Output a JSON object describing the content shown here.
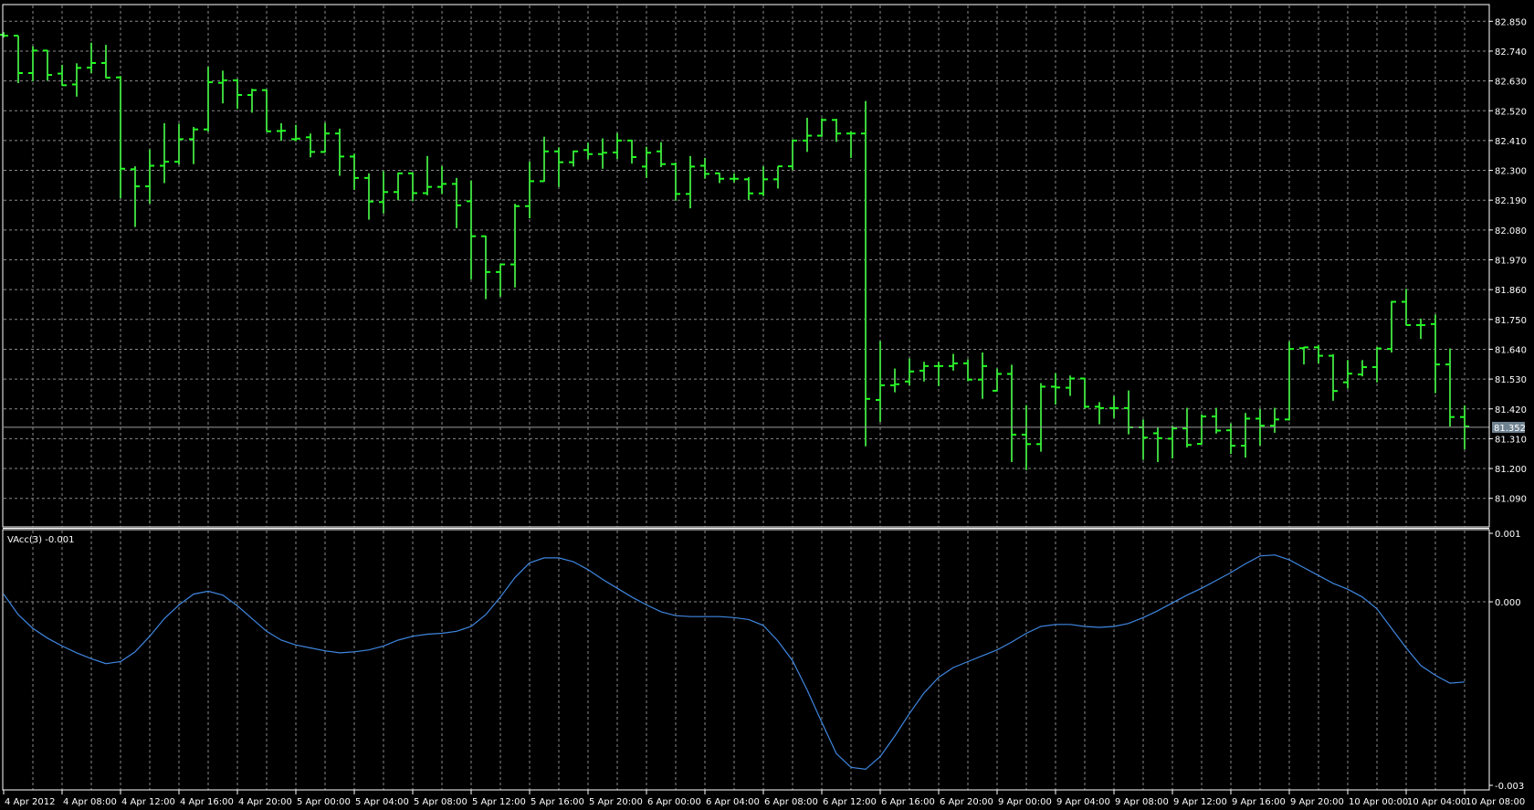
{
  "chart_data": [
    {
      "type": "ohlc",
      "title": "",
      "bar_color": "#3ccf3c",
      "tick_color": "#22ff22",
      "background": "#000000",
      "ylim": [
        81.0,
        82.87
      ],
      "y_ticks": [
        "82.850",
        "82.740",
        "82.630",
        "82.520",
        "82.410",
        "82.300",
        "82.190",
        "82.080",
        "81.970",
        "81.860",
        "81.750",
        "81.640",
        "81.530",
        "81.420",
        "81.310",
        "81.200",
        "81.090"
      ],
      "current_price": 81.352,
      "current_price_label": "81.352",
      "current_price_color": "#6f8291",
      "bars_ohlc": [
        [
          82.8,
          82.81,
          82.79,
          82.797
        ],
        [
          82.797,
          82.797,
          82.622,
          82.659
        ],
        [
          82.659,
          82.758,
          82.629,
          82.742
        ],
        [
          82.742,
          82.744,
          82.631,
          82.652
        ],
        [
          82.657,
          82.689,
          82.612,
          82.614
        ],
        [
          82.617,
          82.695,
          82.572,
          82.678
        ],
        [
          82.679,
          82.771,
          82.659,
          82.696
        ],
        [
          82.696,
          82.763,
          82.64,
          82.642
        ],
        [
          82.643,
          82.648,
          82.197,
          82.306
        ],
        [
          82.304,
          82.315,
          82.091,
          82.241
        ],
        [
          82.241,
          82.377,
          82.177,
          82.317
        ],
        [
          82.317,
          82.474,
          82.253,
          82.332
        ],
        [
          82.332,
          82.472,
          82.321,
          82.415
        ],
        [
          82.415,
          82.46,
          82.323,
          82.451
        ],
        [
          82.451,
          82.682,
          82.443,
          82.625
        ],
        [
          82.623,
          82.668,
          82.547,
          82.632
        ],
        [
          82.632,
          82.637,
          82.527,
          82.578
        ],
        [
          82.578,
          82.601,
          82.513,
          82.596
        ],
        [
          82.596,
          82.598,
          82.444,
          82.444
        ],
        [
          82.445,
          82.474,
          82.409,
          82.446
        ],
        [
          82.415,
          82.468,
          82.407,
          82.417
        ],
        [
          82.422,
          82.436,
          82.348,
          82.368
        ],
        [
          82.368,
          82.475,
          82.366,
          82.436
        ],
        [
          82.436,
          82.454,
          82.28,
          82.351
        ],
        [
          82.351,
          82.362,
          82.228,
          82.272
        ],
        [
          82.272,
          82.289,
          82.118,
          82.185
        ],
        [
          82.183,
          82.297,
          82.141,
          82.22
        ],
        [
          82.22,
          82.292,
          82.19,
          82.289
        ],
        [
          82.289,
          82.292,
          82.186,
          82.216
        ],
        [
          82.216,
          82.353,
          82.208,
          82.239
        ],
        [
          82.239,
          82.316,
          82.213,
          82.25
        ],
        [
          82.25,
          82.272,
          82.087,
          82.171
        ],
        [
          82.186,
          82.263,
          81.898,
          82.057
        ],
        [
          82.057,
          82.059,
          81.825,
          81.925
        ],
        [
          81.925,
          81.954,
          81.834,
          81.953
        ],
        [
          81.953,
          82.177,
          81.868,
          82.168
        ],
        [
          82.168,
          82.332,
          82.123,
          82.26
        ],
        [
          82.26,
          82.424,
          82.258,
          82.37
        ],
        [
          82.37,
          82.385,
          82.239,
          82.33
        ],
        [
          82.33,
          82.373,
          82.314,
          82.37
        ],
        [
          82.375,
          82.402,
          82.34,
          82.36
        ],
        [
          82.36,
          82.418,
          82.306,
          82.365
        ],
        [
          82.366,
          82.438,
          82.342,
          82.41
        ],
        [
          82.41,
          82.413,
          82.325,
          82.349
        ],
        [
          82.314,
          82.387,
          82.272,
          82.365
        ],
        [
          82.37,
          82.404,
          82.312,
          82.323
        ],
        [
          82.323,
          82.329,
          82.188,
          82.213
        ],
        [
          82.213,
          82.353,
          82.16,
          82.314
        ],
        [
          82.317,
          82.346,
          82.269,
          82.287
        ],
        [
          82.289,
          82.291,
          82.253,
          82.269
        ],
        [
          82.269,
          82.289,
          82.255,
          82.269
        ],
        [
          82.267,
          82.275,
          82.19,
          82.215
        ],
        [
          82.215,
          82.315,
          82.205,
          82.267
        ],
        [
          82.267,
          82.315,
          82.233,
          82.315
        ],
        [
          82.315,
          82.413,
          82.301,
          82.41
        ],
        [
          82.41,
          82.494,
          82.368,
          82.428
        ],
        [
          82.428,
          82.492,
          82.424,
          82.486
        ],
        [
          82.486,
          82.49,
          82.405,
          82.436
        ],
        [
          82.436,
          82.445,
          82.346,
          82.436
        ],
        [
          82.436,
          82.556,
          81.282,
          81.457
        ],
        [
          81.453,
          81.67,
          81.372,
          81.507
        ],
        [
          81.507,
          81.569,
          81.481,
          81.511
        ],
        [
          81.521,
          81.606,
          81.507,
          81.558
        ],
        [
          81.561,
          81.594,
          81.521,
          81.578
        ],
        [
          81.578,
          81.594,
          81.504,
          81.578
        ],
        [
          81.578,
          81.623,
          81.561,
          81.588
        ],
        [
          81.588,
          81.603,
          81.522,
          81.528
        ],
        [
          81.528,
          81.628,
          81.457,
          81.578
        ],
        [
          81.487,
          81.569,
          81.485,
          81.549
        ],
        [
          81.549,
          81.583,
          81.224,
          81.325
        ],
        [
          81.325,
          81.434,
          81.194,
          81.29
        ],
        [
          81.29,
          81.515,
          81.262,
          81.502
        ],
        [
          81.502,
          81.552,
          81.436,
          81.499
        ],
        [
          81.498,
          81.543,
          81.468,
          81.532
        ],
        [
          81.532,
          81.535,
          81.421,
          81.428
        ],
        [
          81.428,
          81.445,
          81.363,
          81.423
        ],
        [
          81.423,
          81.468,
          81.386,
          81.423
        ],
        [
          81.423,
          81.488,
          81.326,
          81.352
        ],
        [
          81.352,
          81.381,
          81.232,
          81.314
        ],
        [
          81.33,
          81.352,
          81.224,
          81.312
        ],
        [
          81.31,
          81.358,
          81.237,
          81.348
        ],
        [
          81.348,
          81.424,
          81.278,
          81.287
        ],
        [
          81.291,
          81.4,
          81.289,
          81.392
        ],
        [
          81.392,
          81.424,
          81.329,
          81.34
        ],
        [
          81.341,
          81.366,
          81.254,
          81.284
        ],
        [
          81.284,
          81.405,
          81.24,
          81.384
        ],
        [
          81.384,
          81.42,
          81.284,
          81.358
        ],
        [
          81.358,
          81.424,
          81.332,
          81.381
        ],
        [
          81.381,
          81.669,
          81.377,
          81.641
        ],
        [
          81.644,
          81.649,
          81.584,
          81.647
        ],
        [
          81.647,
          81.656,
          81.588,
          81.616
        ],
        [
          81.616,
          81.622,
          81.45,
          81.486
        ],
        [
          81.518,
          81.6,
          81.495,
          81.55
        ],
        [
          81.547,
          81.6,
          81.54,
          81.574
        ],
        [
          81.574,
          81.649,
          81.518,
          81.643
        ],
        [
          81.641,
          81.818,
          81.628,
          81.815
        ],
        [
          81.815,
          81.863,
          81.729,
          81.729
        ],
        [
          81.729,
          81.753,
          81.678,
          81.729
        ],
        [
          81.733,
          81.768,
          81.478,
          81.584
        ],
        [
          81.584,
          81.643,
          81.355,
          81.39
        ],
        [
          81.39,
          81.433,
          81.271,
          81.355
        ]
      ]
    },
    {
      "type": "line",
      "indicator_label": "VAcc(3) -0.001",
      "line_color": "#3f86e0",
      "ylim": [
        -0.00275,
        0.00106
      ],
      "y_ticks": [
        {
          "value": 0.001,
          "label": "0.001"
        },
        {
          "value": 0.0,
          "label": "0.000"
        },
        {
          "value": -0.00275,
          "label": "-0.003"
        }
      ],
      "values": [
        0.000112,
        -0.000188,
        -0.000388,
        -0.000531,
        -0.000645,
        -0.000745,
        -0.000831,
        -0.000903,
        -0.000873,
        -0.000731,
        -0.000503,
        -0.000245,
        -4.5e-05,
        0.000112,
        0.000155,
        9.7e-05,
        -5.9e-05,
        -0.000245,
        -0.000431,
        -0.00056,
        -0.000631,
        -0.000673,
        -0.000716,
        -0.000745,
        -0.000731,
        -0.000703,
        -0.000645,
        -0.00056,
        -0.000503,
        -0.000473,
        -0.00046,
        -0.000431,
        -0.00036,
        -0.000188,
        6.9e-05,
        0.000355,
        0.000569,
        0.000641,
        0.000641,
        0.000584,
        0.000469,
        0.000327,
        0.000197,
        6.9e-05,
        -4.5e-05,
        -0.000145,
        -0.000203,
        -0.000216,
        -0.000216,
        -0.000216,
        -0.000231,
        -0.000259,
        -0.000345,
        -0.000573,
        -0.00086,
        -0.001288,
        -0.00176,
        -0.002217,
        -0.002417,
        -0.002445,
        -0.00226,
        -0.00196,
        -0.001631,
        -0.001331,
        -0.001103,
        -0.00096,
        -0.000873,
        -0.000788,
        -0.000703,
        -0.000588,
        -0.00046,
        -0.00036,
        -0.000331,
        -0.000331,
        -0.00036,
        -0.000373,
        -0.00036,
        -0.000316,
        -0.000231,
        -0.000131,
        -1.6e-05,
        9.7e-05,
        0.000197,
        0.000312,
        0.000427,
        0.000555,
        0.000669,
        0.000684,
        0.000612,
        0.000499,
        0.000384,
        0.000269,
        0.000184,
        6.9e-05,
        -0.000103,
        -0.000388,
        -0.000673,
        -0.000931,
        -0.001073,
        -0.001188,
        -0.00117
      ]
    }
  ],
  "x_axis": {
    "labels": [
      "4 Apr 2012",
      "4 Apr 08:00",
      "4 Apr 12:00",
      "4 Apr 16:00",
      "4 Apr 20:00",
      "5 Apr 00:00",
      "5 Apr 04:00",
      "5 Apr 08:00",
      "5 Apr 12:00",
      "5 Apr 16:00",
      "5 Apr 20:00",
      "6 Apr 00:00",
      "6 Apr 04:00",
      "6 Apr 08:00",
      "6 Apr 12:00",
      "6 Apr 16:00",
      "6 Apr 20:00",
      "9 Apr 00:00",
      "9 Apr 04:00",
      "9 Apr 08:00",
      "9 Apr 12:00",
      "9 Apr 16:00",
      "9 Apr 20:00",
      "10 Apr 00:00",
      "10 Apr 04:00",
      "10 Apr 08:00"
    ]
  }
}
